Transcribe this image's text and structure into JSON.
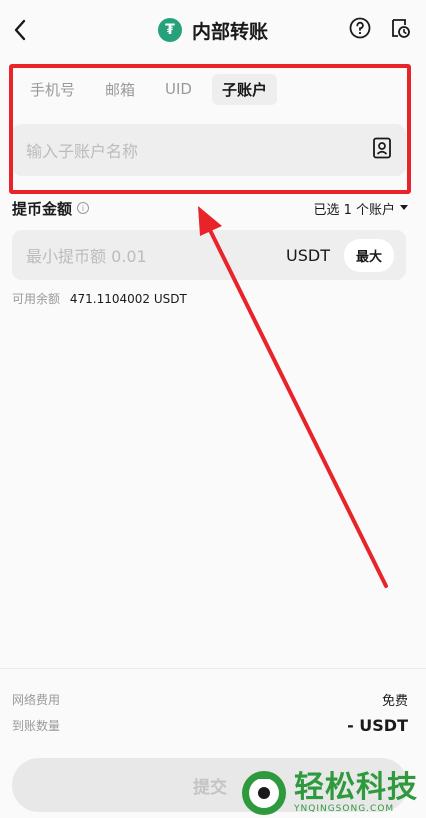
{
  "header": {
    "title": "内部转账",
    "coin_symbol": "₮",
    "coin_color": "#26a17b",
    "icons": [
      "back-icon",
      "help-icon",
      "history-icon"
    ]
  },
  "tabs": [
    {
      "label": "手机号",
      "active": false
    },
    {
      "label": "邮箱",
      "active": false
    },
    {
      "label": "UID",
      "active": false
    },
    {
      "label": "子账户",
      "active": true
    }
  ],
  "subaccount_input": {
    "placeholder": "输入子账户名称",
    "icon": "contacts-icon"
  },
  "amount": {
    "label": "提币金额",
    "selected_accounts": "已选 1 个账户",
    "placeholder": "最小提币额 0.01",
    "unit": "USDT",
    "max_label": "最大"
  },
  "balance": {
    "label": "可用余额",
    "value": "471.1104002 USDT"
  },
  "fees": {
    "network_fee_label": "网络费用",
    "network_fee_value": "免费",
    "receive_label": "到账数量",
    "receive_value": "- USDT"
  },
  "submit_label": "提交",
  "watermark": {
    "main": "轻松科技",
    "sub": "YNQINGSONG.COM"
  },
  "annotation_color": "#e8232a"
}
